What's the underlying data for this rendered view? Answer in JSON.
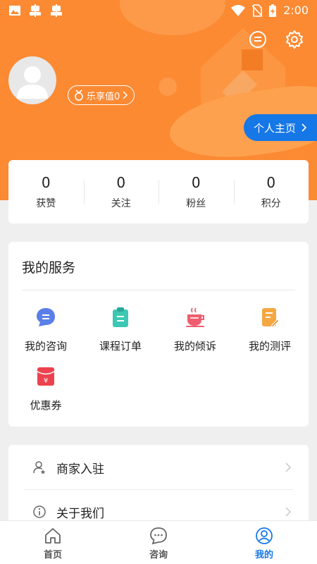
{
  "status_bar": {
    "time": "2:00",
    "app_icons": [
      "image-icon",
      "bug-icon",
      "bug-icon"
    ]
  },
  "profile": {
    "score_label": "乐享值0",
    "home_button_label": "个人主页"
  },
  "stats": [
    {
      "value": "0",
      "label": "获赞"
    },
    {
      "value": "0",
      "label": "关注"
    },
    {
      "value": "0",
      "label": "粉丝"
    },
    {
      "value": "0",
      "label": "积分"
    }
  ],
  "services": {
    "title": "我的服务",
    "items": [
      {
        "label": "我的咨询",
        "icon": "chat-bubble-icon",
        "color": "#5b7fe8"
      },
      {
        "label": "课程订单",
        "icon": "clipboard-icon",
        "color": "#3cc8b4"
      },
      {
        "label": "我的倾诉",
        "icon": "coffee-cup-icon",
        "color": "#ef5d6e"
      },
      {
        "label": "我的测评",
        "icon": "document-edit-icon",
        "color": "#f5a742"
      },
      {
        "label": "优惠券",
        "icon": "red-envelope-icon",
        "color": "#ec4250"
      }
    ]
  },
  "menu": [
    {
      "label": "商家入驻",
      "icon": "user-star-icon"
    },
    {
      "label": "关于我们",
      "icon": "info-icon"
    }
  ],
  "tabs": [
    {
      "label": "首页",
      "icon": "home-icon"
    },
    {
      "label": "咨询",
      "icon": "chat-icon"
    },
    {
      "label": "我的",
      "icon": "profile-icon",
      "active": true
    }
  ],
  "colors": {
    "header": "#fb8a33",
    "accent": "#1677e6",
    "background": "#efefef"
  }
}
